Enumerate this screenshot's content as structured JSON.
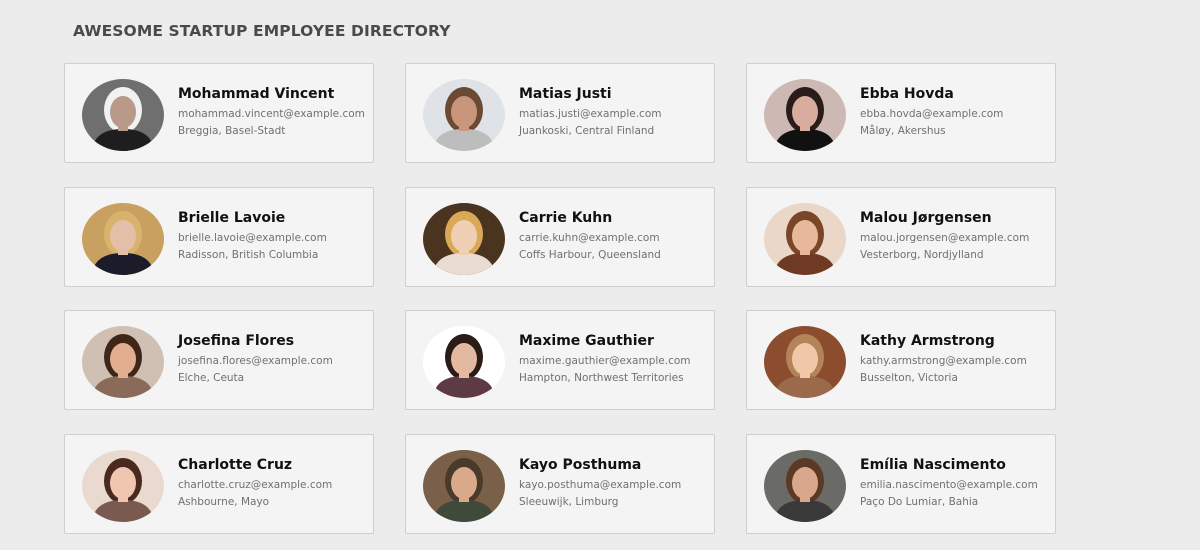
{
  "page": {
    "title": "AWESOME STARTUP EMPLOYEE DIRECTORY"
  },
  "employees": [
    {
      "name": "Mohammad Vincent",
      "email": "mohammad.vincent@example.com",
      "location": "Breggia, Basel-Stadt",
      "avatar": {
        "bg": "#6f6f6f",
        "skin": "#b99a88",
        "hair": "#f1f1f1",
        "shirt": "#1e1e1e"
      }
    },
    {
      "name": "Matias Justi",
      "email": "matias.justi@example.com",
      "location": "Juankoski, Central Finland",
      "avatar": {
        "bg": "#dfe3e8",
        "skin": "#c9967c",
        "hair": "#6b4a34",
        "shirt": "#bdbdbd"
      }
    },
    {
      "name": "Ebba Hovda",
      "email": "ebba.hovda@example.com",
      "location": "Måløy, Akershus",
      "avatar": {
        "bg": "#cdb9b3",
        "skin": "#d8ada0",
        "hair": "#2a1c18",
        "shirt": "#111111"
      }
    },
    {
      "name": "Brielle Lavoie",
      "email": "brielle.lavoie@example.com",
      "location": "Radisson, British Columbia",
      "avatar": {
        "bg": "#c8a060",
        "skin": "#e2bfa6",
        "hair": "#d9b36e",
        "shirt": "#1b1b2a"
      }
    },
    {
      "name": "Carrie Kuhn",
      "email": "carrie.kuhn@example.com",
      "location": "Coffs Harbour, Queensland",
      "avatar": {
        "bg": "#4a3420",
        "skin": "#efcfb4",
        "hair": "#d9a957",
        "shirt": "#e9dcd2"
      }
    },
    {
      "name": "Malou Jørgensen",
      "email": "malou.jorgensen@example.com",
      "location": "Vesterborg, Nordjylland",
      "avatar": {
        "bg": "#ead7c8",
        "skin": "#e7b89a",
        "hair": "#7a4628",
        "shirt": "#6e3a24"
      }
    },
    {
      "name": "Josefina Flores",
      "email": "josefina.flores@example.com",
      "location": "Elche, Ceuta",
      "avatar": {
        "bg": "#cfc0b3",
        "skin": "#e1ae8f",
        "hair": "#3e2618",
        "shirt": "#8a6a58"
      }
    },
    {
      "name": "Maxime Gauthier",
      "email": "maxime.gauthier@example.com",
      "location": "Hampton, Northwest Territories",
      "avatar": {
        "bg": "#ffffff",
        "skin": "#e3b9a0",
        "hair": "#2a1c16",
        "shirt": "#5e3a44"
      }
    },
    {
      "name": "Kathy Armstrong",
      "email": "kathy.armstrong@example.com",
      "location": "Busselton, Victoria",
      "avatar": {
        "bg": "#8c4d2e",
        "skin": "#f0c8a8",
        "hair": "#b3845a",
        "shirt": "#9a6a4a"
      }
    },
    {
      "name": "Charlotte Cruz",
      "email": "charlotte.cruz@example.com",
      "location": "Ashbourne, Mayo",
      "avatar": {
        "bg": "#ead9cf",
        "skin": "#f1c6b0",
        "hair": "#4a2a1e",
        "shirt": "#7a5a50"
      }
    },
    {
      "name": "Kayo Posthuma",
      "email": "kayo.posthuma@example.com",
      "location": "Sleeuwijk, Limburg",
      "avatar": {
        "bg": "#7a6048",
        "skin": "#d9a98a",
        "hair": "#4a3a2c",
        "shirt": "#3f4a3a"
      }
    },
    {
      "name": "Emília Nascimento",
      "email": "emilia.nascimento@example.com",
      "location": "Paço Do Lumiar, Bahia",
      "avatar": {
        "bg": "#6a6a66",
        "skin": "#d9a78c",
        "hair": "#5a3a24",
        "shirt": "#3a3a3a"
      }
    }
  ]
}
